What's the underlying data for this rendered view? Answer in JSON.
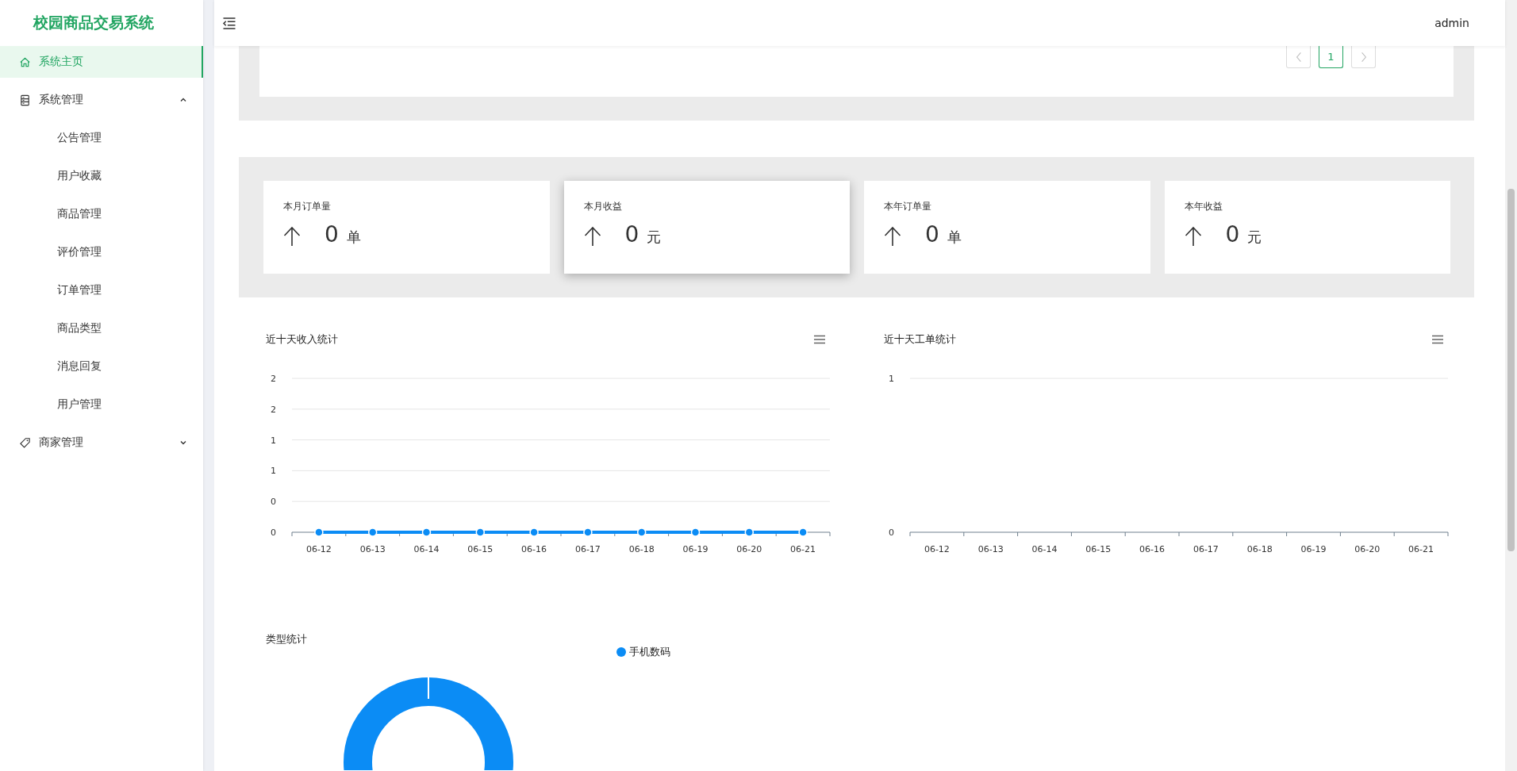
{
  "sidebar": {
    "title": "校园商品交易系统",
    "items": [
      {
        "label": "系统主页",
        "selected": true
      },
      {
        "label": "系统管理",
        "selected": false,
        "expanded": true,
        "children": [
          {
            "label": "公告管理",
            "selected": false
          },
          {
            "label": "用户收藏",
            "selected": false
          },
          {
            "label": "商品管理",
            "selected": false
          },
          {
            "label": "评价管理",
            "selected": false
          },
          {
            "label": "订单管理",
            "selected": false
          },
          {
            "label": "商品类型",
            "selected": false
          },
          {
            "label": "消息回复",
            "selected": false
          },
          {
            "label": "用户管理",
            "selected": false
          }
        ]
      },
      {
        "label": "商家管理",
        "selected": false,
        "expanded": false
      }
    ]
  },
  "header": {
    "user": "admin"
  },
  "pagination": {
    "pages": [
      {
        "label": "1",
        "selected": true
      }
    ]
  },
  "stats": [
    {
      "label": "本月订单量",
      "value": "0",
      "unit": "单",
      "highlighted": false
    },
    {
      "label": "本月收益",
      "value": "0",
      "unit": "元",
      "highlighted": true
    },
    {
      "label": "本年订单量",
      "value": "0",
      "unit": "单",
      "highlighted": false
    },
    {
      "label": "本年收益",
      "value": "0",
      "unit": "元",
      "highlighted": false
    }
  ],
  "charts": [
    {
      "title": "近十天收入统计",
      "chart_data": {
        "type": "line",
        "categories": [
          "06-12",
          "06-13",
          "06-14",
          "06-15",
          "06-16",
          "06-17",
          "06-18",
          "06-19",
          "06-20",
          "06-21"
        ],
        "ylim": [
          0,
          2
        ],
        "yticks": [
          {
            "value": 0,
            "label": "0"
          },
          {
            "value": 0.4,
            "label": "0"
          },
          {
            "value": 0.8,
            "label": "1"
          },
          {
            "value": 1.2,
            "label": "1"
          },
          {
            "value": 1.6,
            "label": "2"
          },
          {
            "value": 2,
            "label": "2"
          }
        ],
        "grid": true,
        "series": [
          {
            "color": "#0b8cf5",
            "marker": true,
            "values": [
              0,
              0,
              0,
              0,
              0,
              0,
              0,
              0,
              0,
              0
            ]
          }
        ]
      }
    },
    {
      "title": "近十天工单统计",
      "chart_data": {
        "type": "line",
        "categories": [
          "06-12",
          "06-13",
          "06-14",
          "06-15",
          "06-16",
          "06-17",
          "06-18",
          "06-19",
          "06-20",
          "06-21"
        ],
        "ylim": [
          0,
          1
        ],
        "grid": true,
        "yticks": [
          {
            "value": 0,
            "label": "0"
          },
          {
            "value": 1,
            "label": "1"
          }
        ]
      }
    }
  ],
  "type_chart": {
    "title": "类型统计",
    "legend": [
      {
        "label": "手机数码",
        "color": "#0b8cf5"
      }
    ]
  }
}
